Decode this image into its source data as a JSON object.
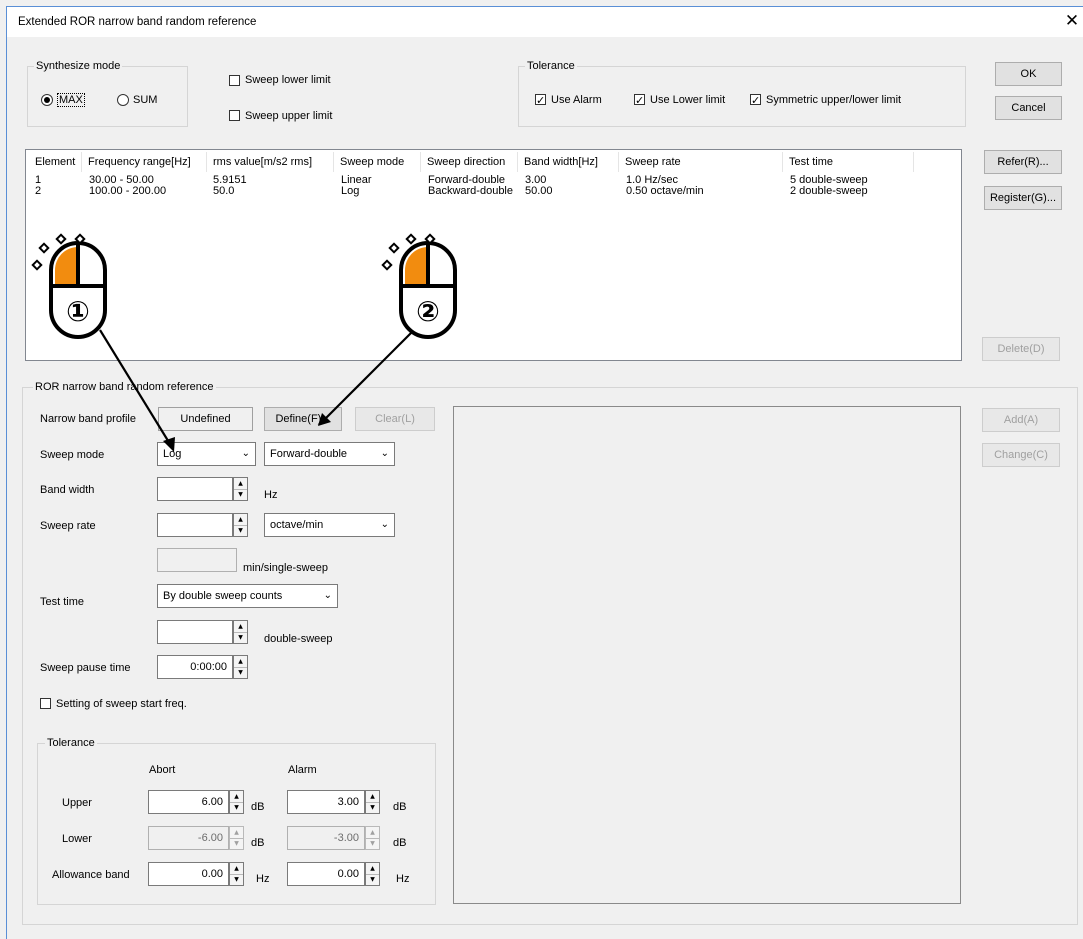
{
  "dialog": {
    "title": "Extended ROR narrow band random reference"
  },
  "synthesize": {
    "label": "Synthesize mode",
    "max": "MAX",
    "sum": "SUM",
    "selected": "MAX"
  },
  "sweep_limits": {
    "lower": "Sweep lower limit",
    "upper": "Sweep upper limit"
  },
  "tolerance_top": {
    "label": "Tolerance",
    "use_alarm": "Use Alarm",
    "use_lower": "Use Lower limit",
    "symmetric": "Symmetric upper/lower limit"
  },
  "buttons": {
    "ok": "OK",
    "cancel": "Cancel",
    "refer": "Refer(R)...",
    "register": "Register(G)...",
    "delete": "Delete(D)",
    "add": "Add(A)",
    "change": "Change(C)",
    "define": "Define(F)...",
    "clear": "Clear(L)"
  },
  "table": {
    "headers": [
      "Element",
      "Frequency range[Hz]",
      "rms value[m/s2 rms]",
      "Sweep mode",
      "Sweep direction",
      "Band width[Hz]",
      "Sweep rate",
      "Test time"
    ],
    "rows": [
      [
        "1",
        "30.00 - 50.00",
        "5.9151",
        "Linear",
        "Forward-double",
        "3.00",
        "1.0 Hz/sec",
        "5 double-sweep"
      ],
      [
        "2",
        "100.00 - 200.00",
        "50.0",
        "Log",
        "Backward-double",
        "50.00",
        "0.50 octave/min",
        "2 double-sweep"
      ]
    ]
  },
  "ror": {
    "group_label": "ROR narrow band random reference",
    "profile_label": "Narrow band profile",
    "profile_value": "Undefined",
    "sweep_mode_label": "Sweep mode",
    "sweep_mode_value": "Log",
    "sweep_dir_value": "Forward-double",
    "band_width_label": "Band width",
    "band_width_value": "",
    "band_width_unit": "Hz",
    "sweep_rate_label": "Sweep rate",
    "sweep_rate_value": "",
    "sweep_rate_unit": "octave/min",
    "single_sweep_value": "",
    "single_sweep_unit": "min/single-sweep",
    "test_time_label": "Test time",
    "test_time_mode": "By double sweep counts",
    "double_sweep_value": "",
    "double_sweep_unit": "double-sweep",
    "pause_label": "Sweep pause time",
    "pause_value": "0:00:00",
    "start_freq_label": "Setting of sweep start freq."
  },
  "tolerance_bottom": {
    "label": "Tolerance",
    "abort": "Abort",
    "alarm": "Alarm",
    "upper_label": "Upper",
    "lower_label": "Lower",
    "allowance_label": "Allowance band",
    "upper_abort": "6.00",
    "upper_alarm": "3.00",
    "lower_abort": "-6.00",
    "lower_alarm": "-3.00",
    "allow_abort": "0.00",
    "allow_alarm": "0.00",
    "db": "dB",
    "hz": "Hz"
  },
  "annotations": {
    "mouse1": "①",
    "mouse2": "②",
    "accent": "#f28c0f"
  }
}
